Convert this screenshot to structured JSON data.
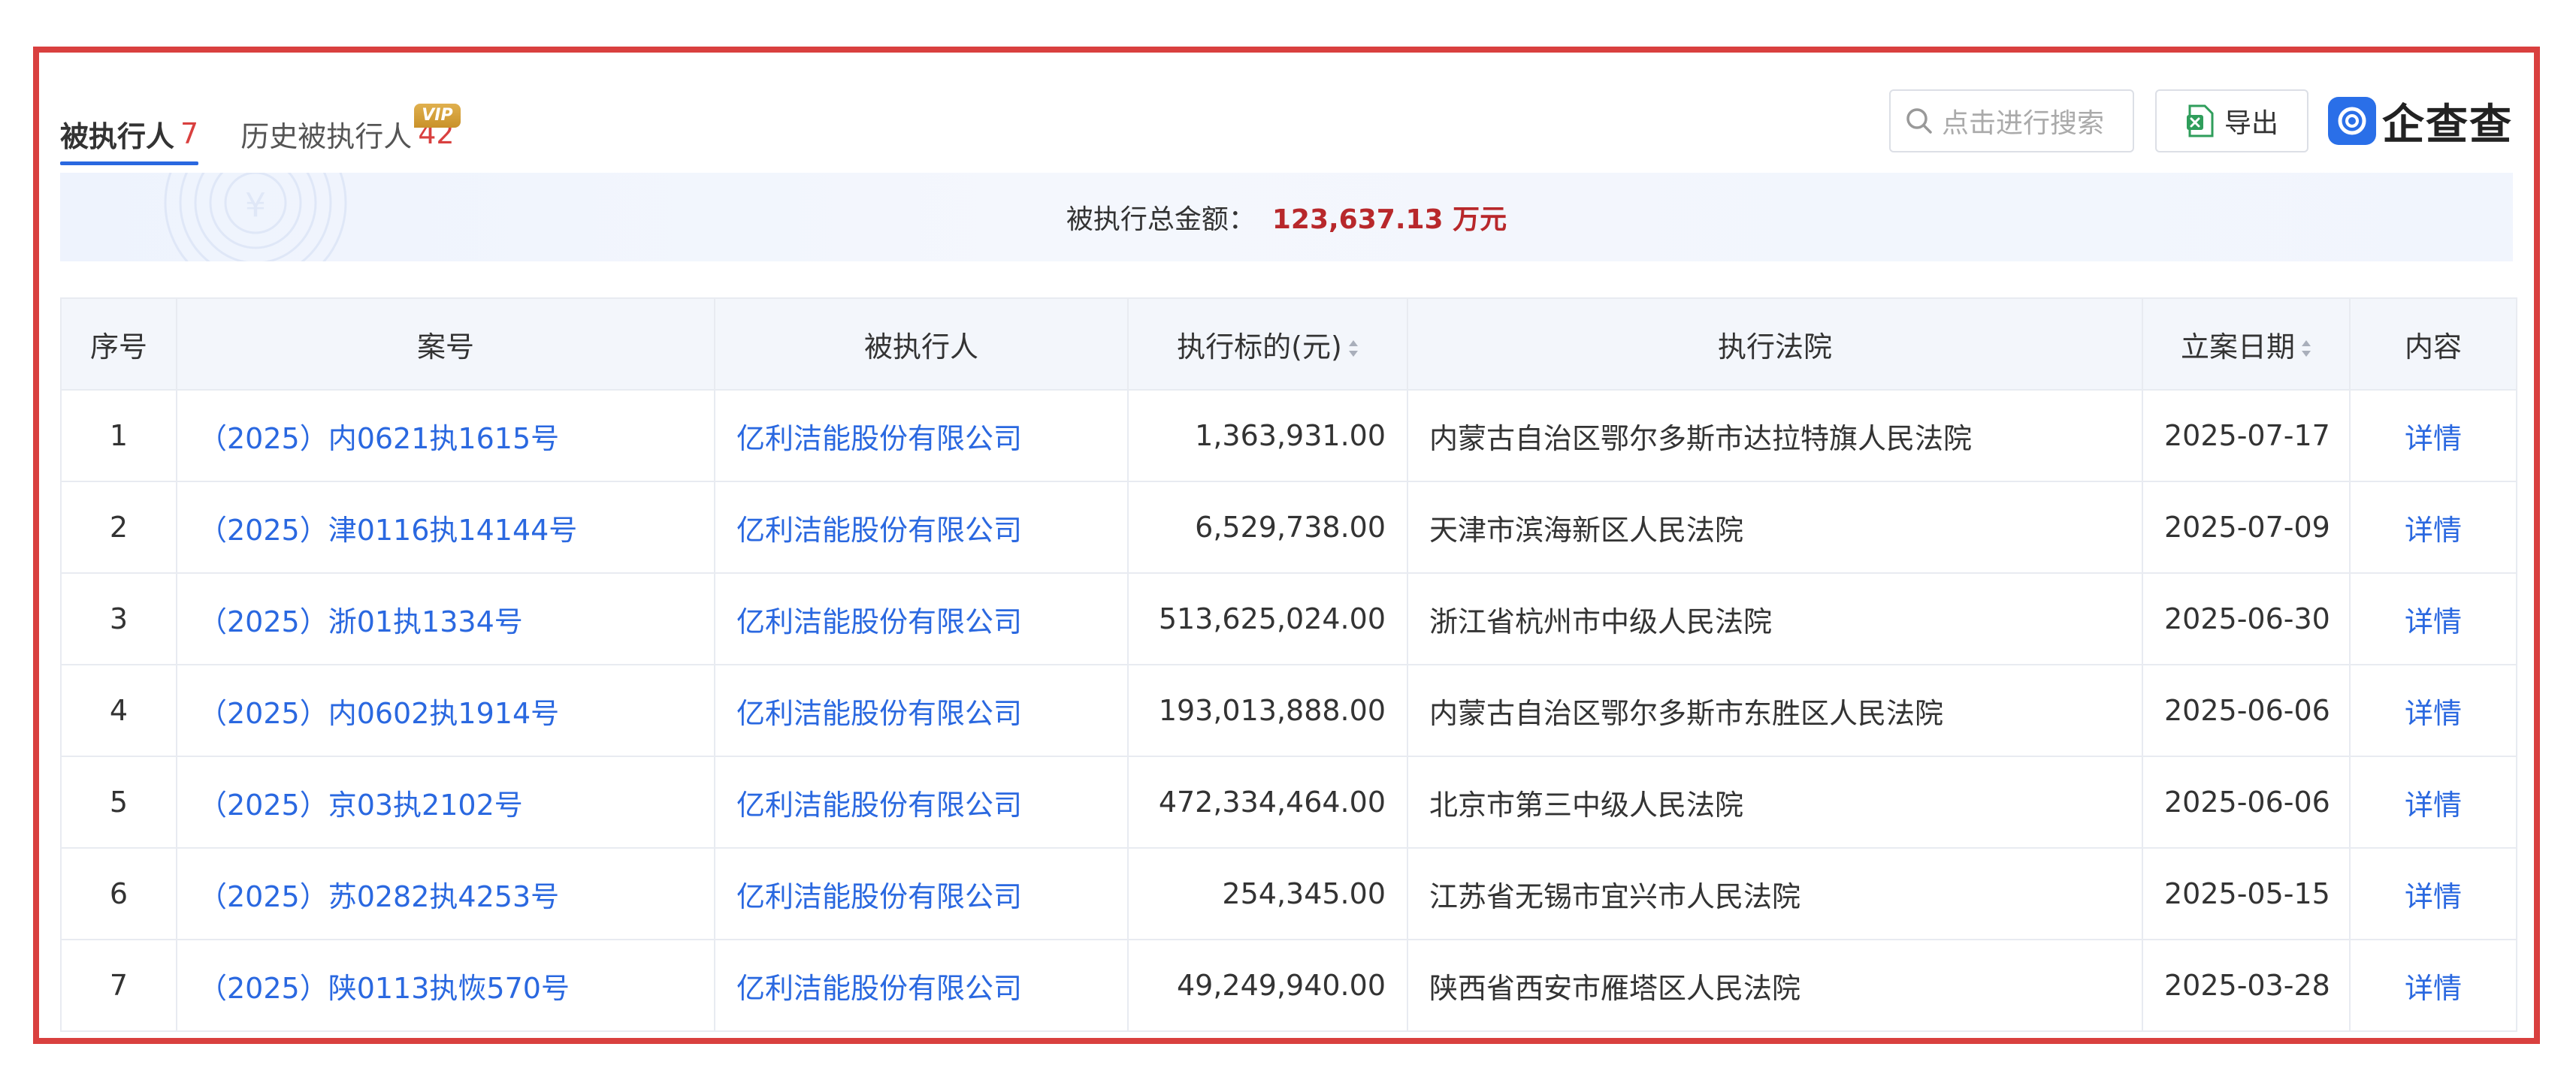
{
  "tabs": [
    {
      "label": "被执行人",
      "count": "7",
      "active": true
    },
    {
      "label": "历史被执行人",
      "count": "42",
      "badge": "VIP",
      "active": false
    }
  ],
  "search": {
    "placeholder": "点击进行搜索"
  },
  "export": {
    "label": "导出",
    "icon": "excel-icon"
  },
  "logo": {
    "text": "企查查",
    "icon": "qichacha-logo-icon"
  },
  "summary": {
    "label": "被执行总金额：",
    "value": "123,637.13 万元"
  },
  "table": {
    "headers": {
      "index": "序号",
      "case_no": "案号",
      "party": "被执行人",
      "amount": "执行标的(元)",
      "court": "执行法院",
      "date": "立案日期",
      "content": "内容"
    },
    "rows": [
      {
        "index": "1",
        "case_no": "（2025）内0621执1615号",
        "party": "亿利洁能股份有限公司",
        "amount": "1,363,931.00",
        "court": "内蒙古自治区鄂尔多斯市达拉特旗人民法院",
        "date": "2025-07-17",
        "content": "详情"
      },
      {
        "index": "2",
        "case_no": "（2025）津0116执14144号",
        "party": "亿利洁能股份有限公司",
        "amount": "6,529,738.00",
        "court": "天津市滨海新区人民法院",
        "date": "2025-07-09",
        "content": "详情"
      },
      {
        "index": "3",
        "case_no": "（2025）浙01执1334号",
        "party": "亿利洁能股份有限公司",
        "amount": "513,625,024.00",
        "court": "浙江省杭州市中级人民法院",
        "date": "2025-06-30",
        "content": "详情"
      },
      {
        "index": "4",
        "case_no": "（2025）内0602执1914号",
        "party": "亿利洁能股份有限公司",
        "amount": "193,013,888.00",
        "court": "内蒙古自治区鄂尔多斯市东胜区人民法院",
        "date": "2025-06-06",
        "content": "详情"
      },
      {
        "index": "5",
        "case_no": "（2025）京03执2102号",
        "party": "亿利洁能股份有限公司",
        "amount": "472,334,464.00",
        "court": "北京市第三中级人民法院",
        "date": "2025-06-06",
        "content": "详情"
      },
      {
        "index": "6",
        "case_no": "（2025）苏0282执4253号",
        "party": "亿利洁能股份有限公司",
        "amount": "254,345.00",
        "court": "江苏省无锡市宜兴市人民法院",
        "date": "2025-05-15",
        "content": "详情"
      },
      {
        "index": "7",
        "case_no": "（2025）陕0113执恢570号",
        "party": "亿利洁能股份有限公司",
        "amount": "49,249,940.00",
        "court": "陕西省西安市雁塔区人民法院",
        "date": "2025-03-28",
        "content": "详情"
      }
    ]
  },
  "colors": {
    "accent": "#2a68e0",
    "frame": "#d9403f",
    "amount": "#b8282b",
    "vip": "#d4a03a"
  }
}
